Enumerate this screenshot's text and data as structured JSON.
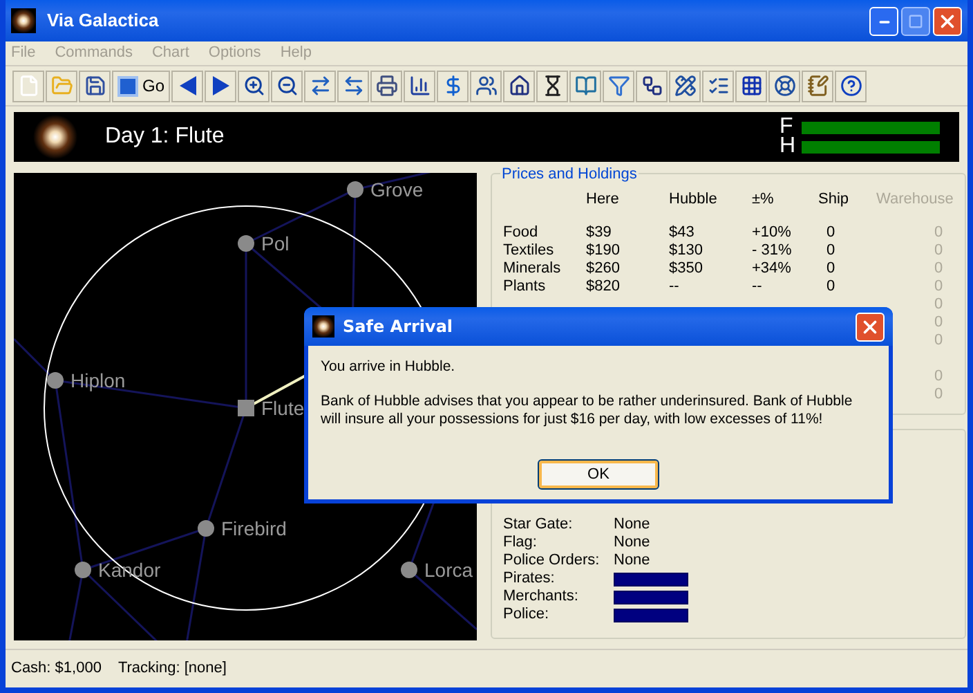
{
  "window": {
    "title": "Via Galactica"
  },
  "menu": [
    "File",
    "Commands",
    "Chart",
    "Options",
    "Help"
  ],
  "toolbar": {
    "go_label": "Go"
  },
  "banner": {
    "title": "Day 1: Flute",
    "meters": [
      {
        "label": "F",
        "level": 1
      },
      {
        "label": "H",
        "level": 1
      }
    ]
  },
  "map": {
    "stars": [
      {
        "name": "Grove",
        "kind": "planet"
      },
      {
        "name": "Pol",
        "kind": "planet"
      },
      {
        "name": "Hiplon",
        "kind": "planet"
      },
      {
        "name": "Flute",
        "kind": "current"
      },
      {
        "name": "Firebird",
        "kind": "planet"
      },
      {
        "name": "Kandor",
        "kind": "planet"
      },
      {
        "name": "Lorca",
        "kind": "planet"
      }
    ]
  },
  "prices": {
    "title": "Prices and Holdings",
    "columns": [
      "Here",
      "Hubble",
      "±%",
      "Ship",
      "Warehouse"
    ],
    "rows": [
      {
        "name": "Food",
        "here": "$39",
        "hubble": "$43",
        "change": "+10%",
        "ship": "0",
        "warehouse": "0"
      },
      {
        "name": "Textiles",
        "here": "$190",
        "hubble": "$130",
        "change": "- 31%",
        "ship": "0",
        "warehouse": "0"
      },
      {
        "name": "Minerals",
        "here": "$260",
        "hubble": "$350",
        "change": "+34%",
        "ship": "0",
        "warehouse": "0"
      },
      {
        "name": "Plants",
        "here": "$820",
        "hubble": "--",
        "change": "--",
        "ship": "0",
        "warehouse": "0"
      },
      {
        "warehouse": "0"
      },
      {
        "warehouse": "0"
      },
      {
        "warehouse": "0"
      }
    ],
    "more_rows": [
      {
        "warehouse": "0"
      },
      {
        "warehouse": "0"
      }
    ]
  },
  "status": {
    "rows": [
      {
        "label": "Star Gate:",
        "value": "None"
      },
      {
        "label": "Flag:",
        "value": "None"
      },
      {
        "label": "Police Orders:",
        "value": "None"
      },
      {
        "label": "Pirates:",
        "level": 1
      },
      {
        "label": "Merchants:",
        "level": 1
      },
      {
        "label": "Police:",
        "level": 1
      }
    ]
  },
  "status_bar": {
    "cash": "Cash: $1,000",
    "tracking": "Tracking: [none]"
  },
  "dialog": {
    "title": "Safe Arrival",
    "lines": [
      "You arrive in Hubble.",
      "Bank of Hubble advises that you appear to be rather underinsured. Bank of Hubble will insure all your possessions for just $16 per day, with low excesses of 11%!"
    ],
    "button": "OK"
  }
}
